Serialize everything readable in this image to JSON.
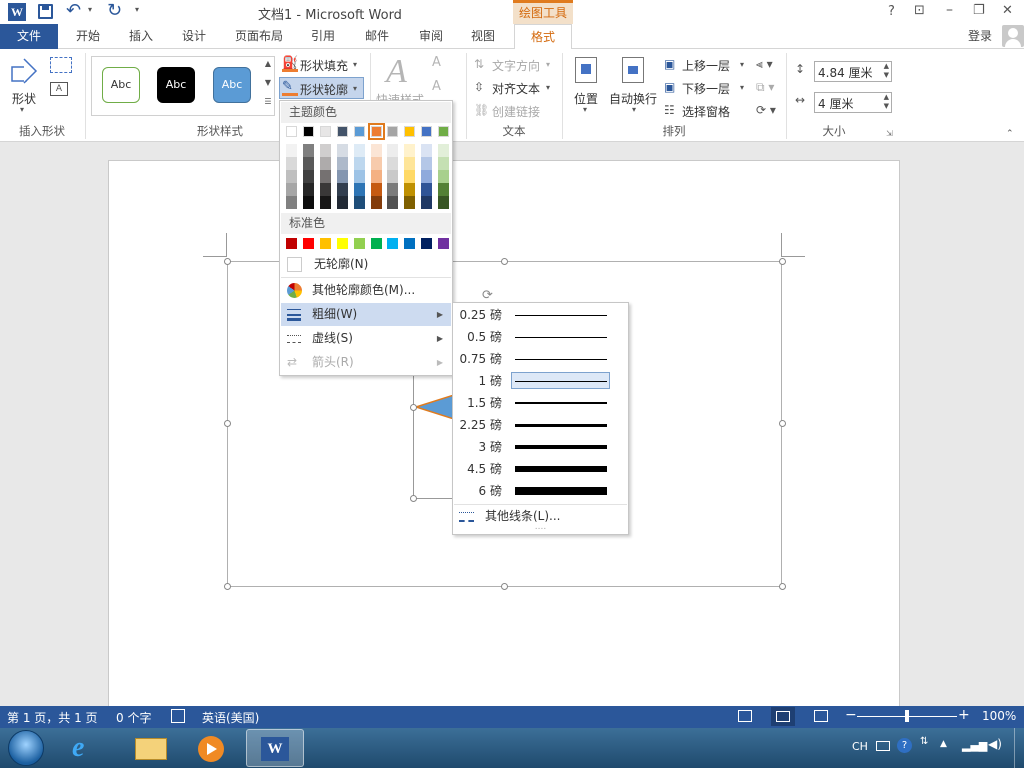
{
  "titlebar": {
    "title": "文档1 - Microsoft Word",
    "drawing_tools": "绘图工具",
    "help": "?",
    "restore_ribbon": "⊡",
    "minimize": "–",
    "maximize": "❐",
    "close": "✕"
  },
  "tabs": {
    "file": "文件",
    "items": [
      "开始",
      "插入",
      "设计",
      "页面布局",
      "引用",
      "邮件",
      "审阅",
      "视图"
    ],
    "active": "格式",
    "login": "登录"
  },
  "ribbon": {
    "insert_shapes": {
      "label": "插入形状",
      "shape_button": "形状"
    },
    "shape_styles": {
      "label": "形状样式",
      "style_samples": [
        "Abc",
        "Abc",
        "Abc"
      ],
      "fill": "形状填充",
      "outline": "形状轮廓"
    },
    "wordart": {
      "quick_styles": "快速样式"
    },
    "text": {
      "label": "文本",
      "direction": "文字方向",
      "align": "对齐文本",
      "link": "创建链接"
    },
    "arrange": {
      "label": "排列",
      "position": "位置",
      "wrap": "自动换行",
      "bring_forward": "上移一层",
      "send_backward": "下移一层",
      "selection_pane": "选择窗格"
    },
    "size": {
      "label": "大小",
      "height": "4.84 厘米",
      "width": "4 厘米"
    }
  },
  "outline_menu": {
    "theme_colors_header": "主题颜色",
    "standard_colors_header": "标准色",
    "theme_colors": [
      "#ffffff",
      "#000000",
      "#e7e6e6",
      "#44546a",
      "#5b9bd5",
      "#ed7d31",
      "#a5a5a5",
      "#ffc000",
      "#4472c4",
      "#70ad47"
    ],
    "theme_shades": [
      [
        "#f2f2f2",
        "#d9d9d9",
        "#bfbfbf",
        "#a6a6a6",
        "#808080"
      ],
      [
        "#7f7f7f",
        "#595959",
        "#404040",
        "#262626",
        "#0d0d0d"
      ],
      [
        "#d0cece",
        "#aeabab",
        "#757171",
        "#3a3838",
        "#171616"
      ],
      [
        "#d6dce4",
        "#adb9ca",
        "#8496b0",
        "#333f4f",
        "#222a35"
      ],
      [
        "#deebf6",
        "#bdd7ee",
        "#9dc3e6",
        "#2e75b5",
        "#1f4e79"
      ],
      [
        "#fbe5d5",
        "#f7cbac",
        "#f4b183",
        "#c55a11",
        "#833c0b"
      ],
      [
        "#ededed",
        "#dbdbdb",
        "#c9c9c9",
        "#7b7b7b",
        "#525252"
      ],
      [
        "#fff2cc",
        "#fee599",
        "#ffd965",
        "#bf9000",
        "#7f6000"
      ],
      [
        "#dae3f3",
        "#b4c7e7",
        "#8faadc",
        "#2f5496",
        "#1f3864"
      ],
      [
        "#e2efd9",
        "#c5e0b3",
        "#a8d08d",
        "#538135",
        "#375623"
      ]
    ],
    "standard_colors": [
      "#c00000",
      "#ff0000",
      "#ffc000",
      "#ffff00",
      "#92d050",
      "#00b050",
      "#00b0f0",
      "#0070c0",
      "#002060",
      "#7030a0"
    ],
    "selected_theme_color": "#ed7d31",
    "no_outline": "无轮廓(N)",
    "more_colors": "其他轮廓颜色(M)...",
    "weight": "粗细(W)",
    "dashes": "虚线(S)",
    "arrows": "箭头(R)"
  },
  "weight_submenu": {
    "items": [
      {
        "label": "0.25 磅",
        "pt": 0.25
      },
      {
        "label": "0.5 磅",
        "pt": 0.5
      },
      {
        "label": "0.75 磅",
        "pt": 0.75
      },
      {
        "label": "1 磅",
        "pt": 1
      },
      {
        "label": "1.5 磅",
        "pt": 1.5
      },
      {
        "label": "2.25 磅",
        "pt": 2.25
      },
      {
        "label": "3 磅",
        "pt": 3
      },
      {
        "label": "4.5 磅",
        "pt": 4.5
      },
      {
        "label": "6 磅",
        "pt": 6
      }
    ],
    "selected": "1 磅",
    "more_lines": "其他线条(L)...",
    "grip": "...."
  },
  "statusbar": {
    "page": "第 1 页，共 1 页",
    "words": "0 个字",
    "language": "英语(美国)",
    "zoom": "100%",
    "zoom_level": 1.0
  },
  "taskbar": {
    "ime": "CH"
  }
}
